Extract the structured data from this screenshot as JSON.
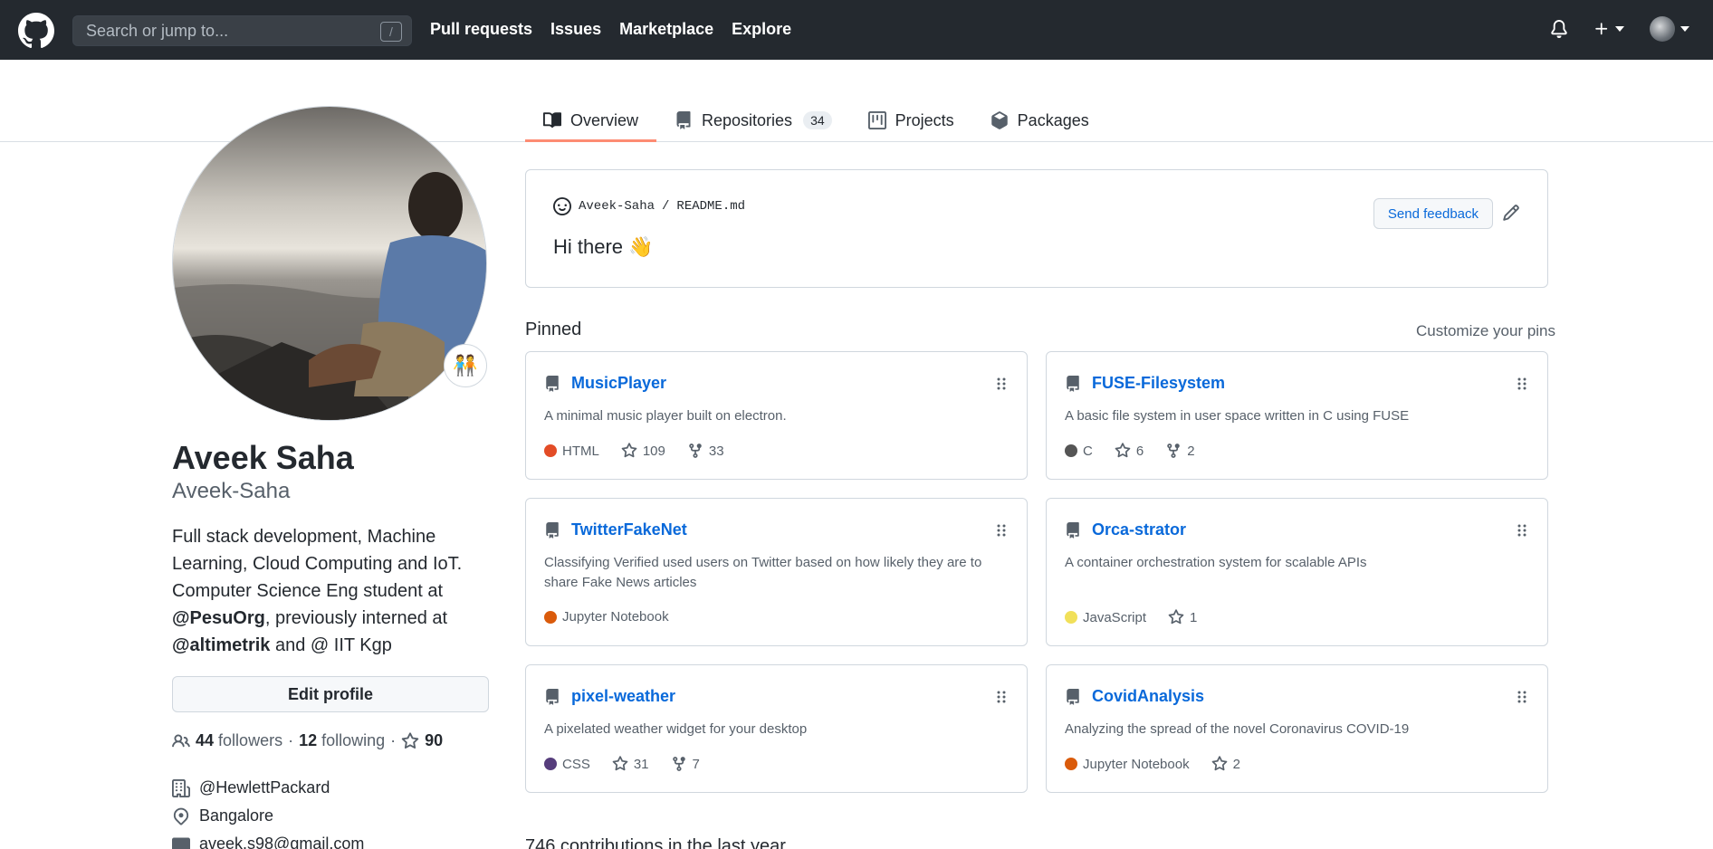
{
  "header": {
    "search_placeholder": "Search or jump to...",
    "slash_key": "/",
    "nav": [
      "Pull requests",
      "Issues",
      "Marketplace",
      "Explore"
    ],
    "plus_label": "+"
  },
  "tabs": [
    {
      "label": "Overview",
      "icon": "book-icon"
    },
    {
      "label": "Repositories",
      "icon": "repo-icon",
      "count": "34"
    },
    {
      "label": "Projects",
      "icon": "project-icon"
    },
    {
      "label": "Packages",
      "icon": "package-icon"
    }
  ],
  "profile": {
    "fullname": "Aveek Saha",
    "username": "Aveek-Saha",
    "bio_line1": "Full stack development, Machine Learning, Cloud Computing and IoT. Computer Science Eng student at ",
    "bio_org1": "@PesuOrg",
    "bio_mid": ", previously interned at ",
    "bio_org2": "@altimetrik",
    "bio_end": " and @ IIT Kgp",
    "edit_label": "Edit profile",
    "followers_count": "44",
    "followers_label": "followers",
    "sep1": "·",
    "following_count": "12",
    "following_label": "following",
    "sep2": "·",
    "stars_count": "90",
    "company": "@HewlettPackard",
    "location": "Bangalore",
    "email": "aveek.s98@gmail.com",
    "status_emoji": "🧑‍🤝‍🧑"
  },
  "readme": {
    "path_user": "Aveek-Saha",
    "path_sep": "/",
    "path_file": "README.md",
    "greeting": "Hi there 👋",
    "feedback_label": "Send feedback"
  },
  "pinned": {
    "title": "Pinned",
    "customize": "Customize your pins",
    "cards": [
      {
        "name": "MusicPlayer",
        "desc": "A minimal music player built on electron.",
        "lang": "HTML",
        "lang_color": "#e34c26",
        "stars": "109",
        "forks": "33"
      },
      {
        "name": "FUSE-Filesystem",
        "desc": "A basic file system in user space written in C using FUSE",
        "lang": "C",
        "lang_color": "#555555",
        "stars": "6",
        "forks": "2"
      },
      {
        "name": "TwitterFakeNet",
        "desc": "Classifying Verified used users on Twitter based on how likely they are to share Fake News articles",
        "lang": "Jupyter Notebook",
        "lang_color": "#DA5B0B",
        "stars": "",
        "forks": ""
      },
      {
        "name": "Orca-strator",
        "desc": "A container orchestration system for scalable APIs",
        "lang": "JavaScript",
        "lang_color": "#f1e05a",
        "stars": "1",
        "forks": ""
      },
      {
        "name": "pixel-weather",
        "desc": "A pixelated weather widget for your desktop",
        "lang": "CSS",
        "lang_color": "#563d7c",
        "stars": "31",
        "forks": "7"
      },
      {
        "name": "CovidAnalysis",
        "desc": "Analyzing the spread of the novel Coronavirus COVID-19",
        "lang": "Jupyter Notebook",
        "lang_color": "#DA5B0B",
        "stars": "2",
        "forks": ""
      }
    ]
  },
  "contributions_heading": "746 contributions in the last year"
}
